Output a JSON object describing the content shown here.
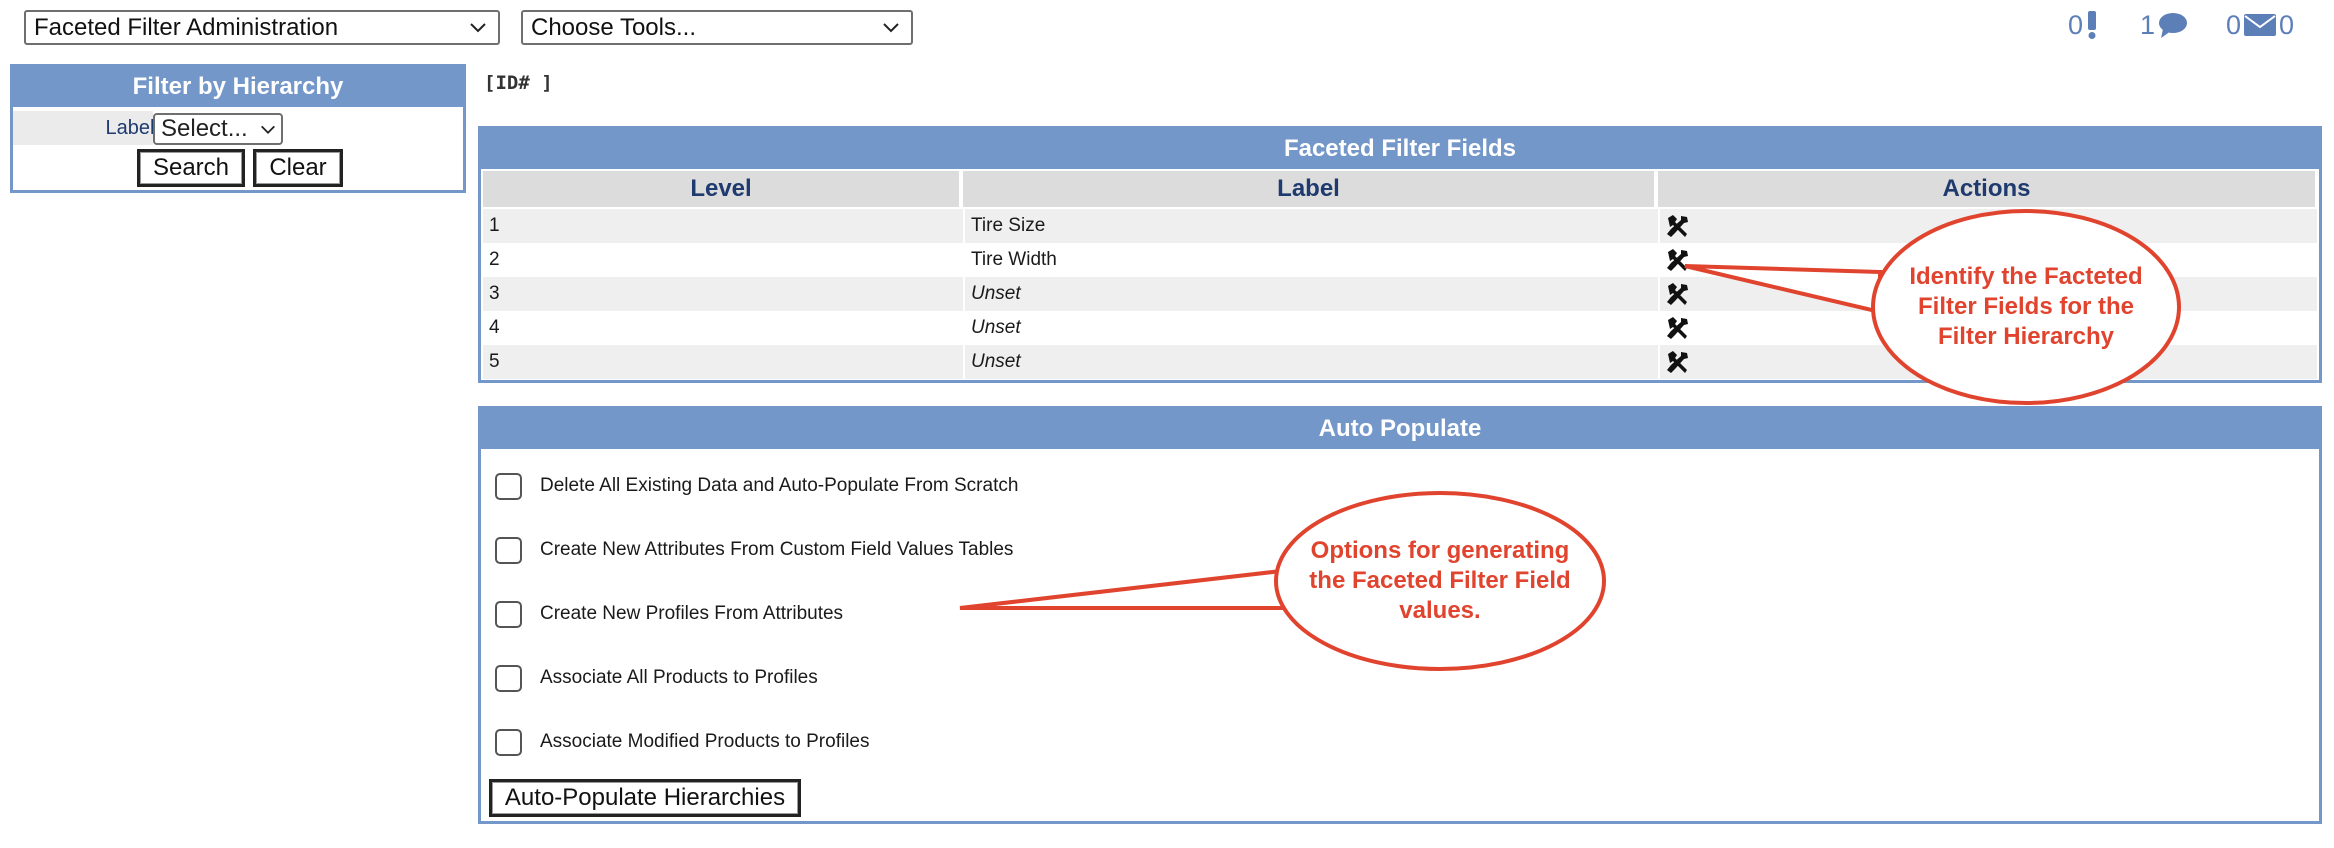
{
  "topbar": {
    "tools_select_value": "Faceted Filter Administration",
    "choose_tools_value": "Choose Tools...",
    "alerts_count": "0",
    "comments_count": "1",
    "messages_count": "0",
    "accent_color": "#5d7fb8"
  },
  "filter_panel": {
    "title": "Filter by Hierarchy",
    "label_text": "Label:",
    "label_select_value": "Select...",
    "search_label": "Search",
    "clear_label": "Clear"
  },
  "id_tag": "[ID# ]",
  "fields_table": {
    "title": "Faceted Filter Fields",
    "headers": [
      "Level",
      "Label",
      "Actions"
    ],
    "rows": [
      {
        "level": "1",
        "label": "Tire Size",
        "action_icon": "tools-icon"
      },
      {
        "level": "2",
        "label": "Tire Width",
        "action_icon": "tools-icon"
      },
      {
        "level": "3",
        "label": "Unset",
        "action_icon": "tools-icon"
      },
      {
        "level": "4",
        "label": "Unset",
        "action_icon": "tools-icon"
      },
      {
        "level": "5",
        "label": "Unset",
        "action_icon": "tools-icon"
      }
    ]
  },
  "auto_populate": {
    "title": "Auto Populate",
    "options": [
      {
        "label": "Delete All Existing Data and Auto-Populate From Scratch",
        "checked": false
      },
      {
        "label": "Create New Attributes From Custom Field Values Tables",
        "checked": false
      },
      {
        "label": "Create New Profiles From Attributes",
        "checked": false
      },
      {
        "label": "Associate All Products to Profiles",
        "checked": false
      },
      {
        "label": "Associate Modified Products to Profiles",
        "checked": false
      }
    ],
    "button_label": "Auto-Populate Hierarchies"
  },
  "callouts": {
    "fields_note": [
      "Identify the Facteted",
      "Filter Fields for the",
      "Filter Hierarchy"
    ],
    "options_note": [
      "Options for generating",
      "the Faceted Filter Field",
      "values."
    ],
    "color": "#e0442e"
  },
  "theme": {
    "header_blue": "#7397c9",
    "header_text_navy": "#1e3a6e"
  }
}
